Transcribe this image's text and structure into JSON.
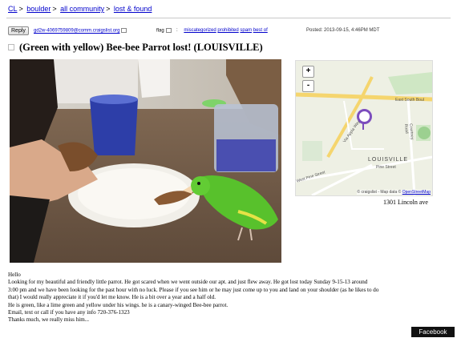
{
  "breadcrumbs": {
    "items": [
      "CL",
      "boulder",
      "all community",
      "lost & found"
    ],
    "separator": ">"
  },
  "toolbar": {
    "reply_label": "Reply",
    "reply_email": "gd2w-4069759809@comm.craigslist.org",
    "flag_label": "flag",
    "flag_links": [
      "miscategorized",
      "prohibited",
      "spam",
      "best of"
    ],
    "posted": "Posted: 2013-09-15, 4:46PM MDT"
  },
  "posting": {
    "title": "(Green with yellow) Bee-bee Parrot lost! (LOUISVILLE)",
    "address": "1301 Lincoln ave",
    "body": [
      "Hello",
      "Looking for my beautiful and friendly little parrot. He got scared when we went outside our apt. and just flew away. He got lost today Sunday 9-15-13 around",
      "3:00 pm and we have been looking for the past hour with no luck. Please if you see him or he may just come up to you and land on your shoulder (as he likes to do",
      "that) I would really appreciate it if you'd let me know. He is a bit over a year and a half old.",
      "He is green, like a lime green and yellow under his wings. he is a canary-winged Bee-bee parrot.",
      "Email, text or call if you have any info 720-376-1323",
      "Thanks much, we really miss him..."
    ]
  },
  "map": {
    "zoom_in": "+",
    "zoom_out": "-",
    "city_label": "LOUISVILLE",
    "street_labels": [
      "East South Boul",
      "Pine Street",
      "West Pine Street",
      "Via Appia Way",
      "Courtney Road"
    ],
    "attribution_prefix": "© craigslist - Map data ©",
    "attribution_link": "OpenStreetMap"
  },
  "badge": {
    "label": "Facebook"
  },
  "colors": {
    "link": "#0000cc",
    "marker": "#7c4dbd",
    "parrot": "#58c12c",
    "badge_bg": "#111111"
  }
}
